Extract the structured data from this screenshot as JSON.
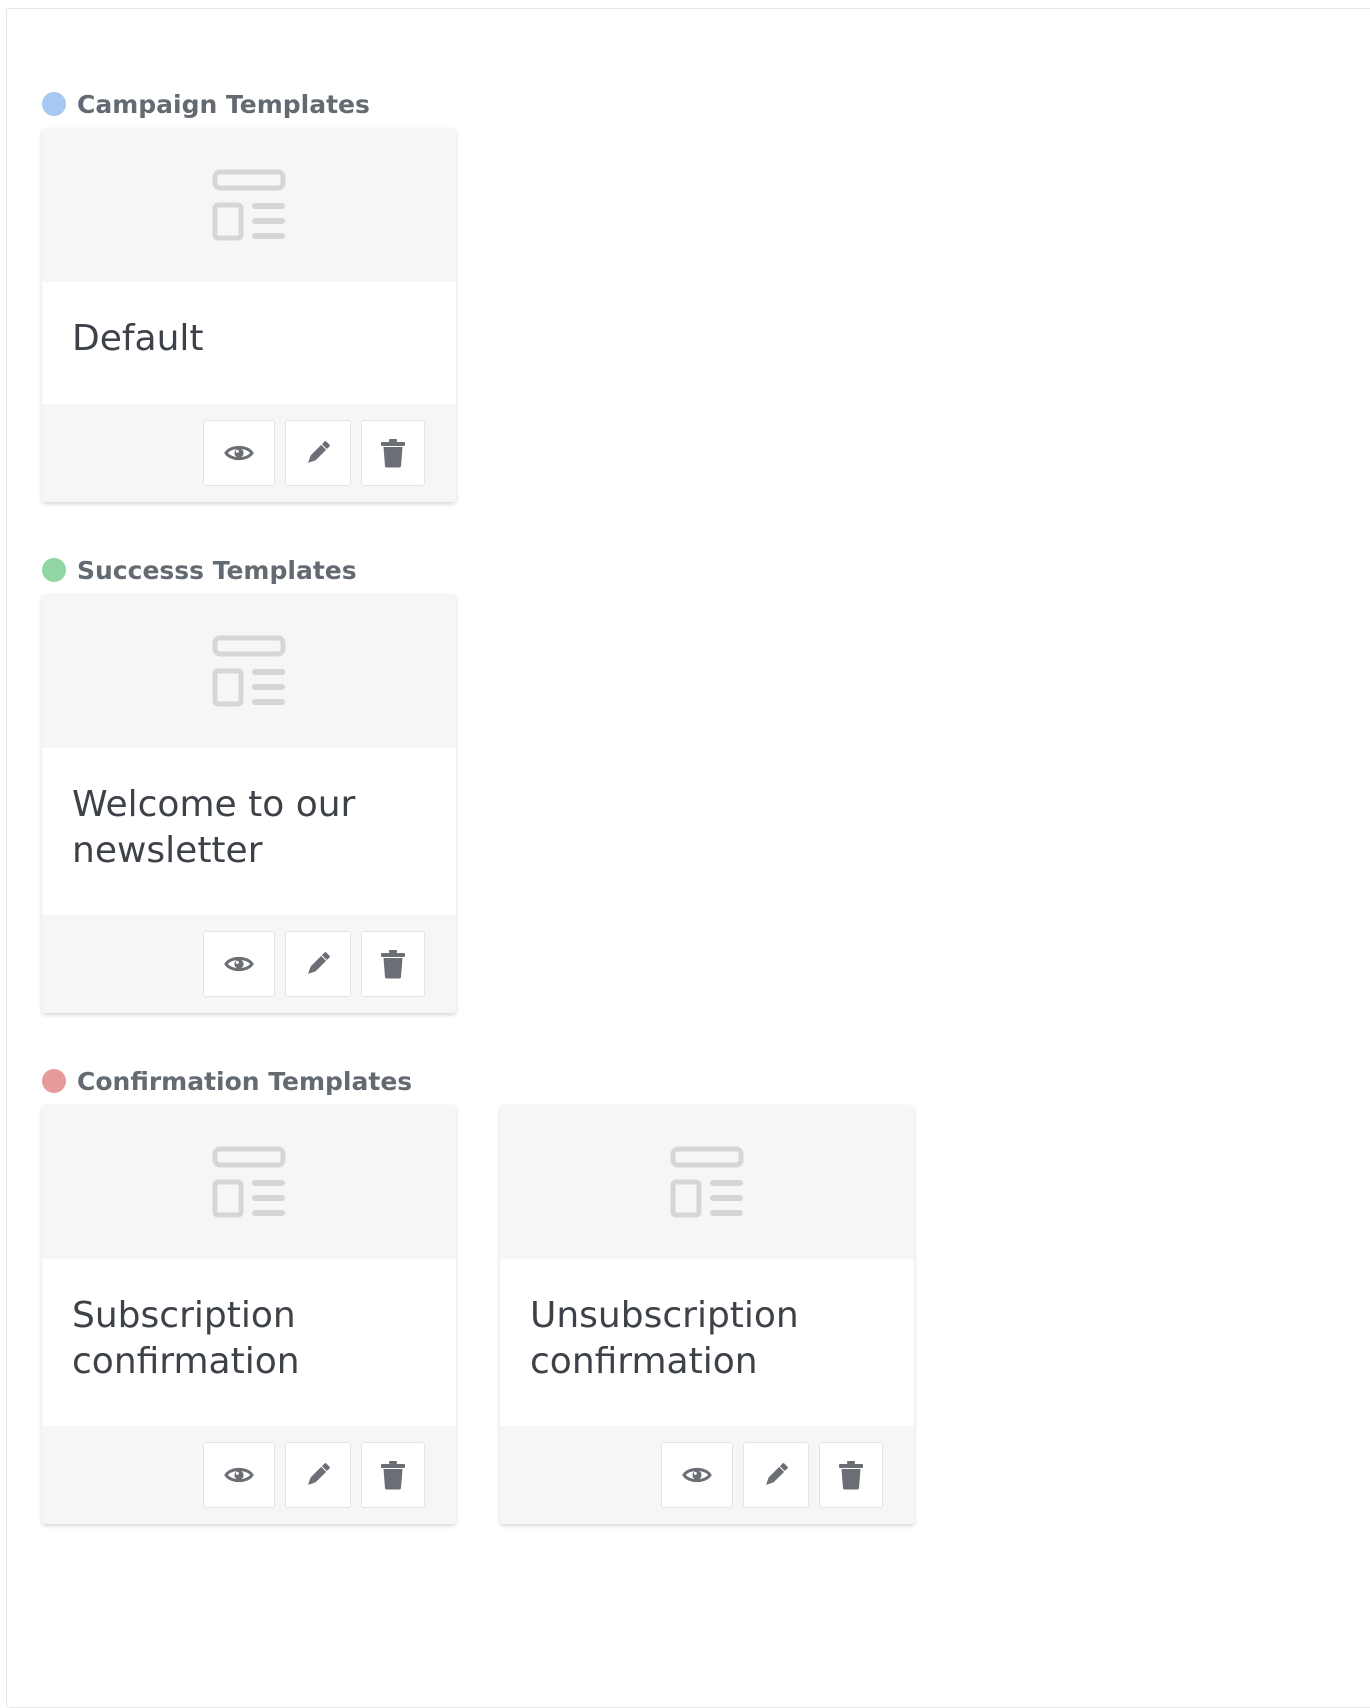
{
  "colors": {
    "campaign_dot": "#a6c8f2",
    "success_dot": "#8fd6a3",
    "confirmation_dot": "#e69a9a",
    "icon_gray": "#6b6f75",
    "thumb_icon": "#d6d6d6"
  },
  "sections": [
    {
      "title": "Campaign Templates",
      "cards": [
        {
          "title": "Default"
        }
      ]
    },
    {
      "title": "Successs Templates",
      "cards": [
        {
          "title": "Welcome to our newsletter"
        }
      ]
    },
    {
      "title": "Confirmation Templates",
      "cards": [
        {
          "title": "Subscription confirmation"
        },
        {
          "title": "Unsubscription confirmation"
        }
      ]
    }
  ],
  "icons": {
    "thumbnail": "template-layout-icon",
    "view": "eye-icon",
    "edit": "pencil-icon",
    "delete": "trash-icon"
  }
}
